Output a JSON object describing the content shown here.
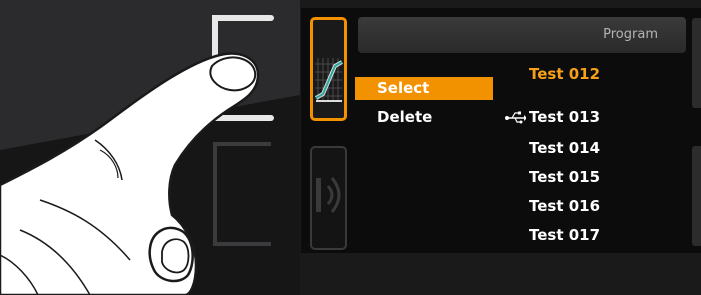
{
  "header": {
    "title": "Program"
  },
  "menu": {
    "items": [
      {
        "label": "Select",
        "selected": true
      },
      {
        "label": "Delete",
        "selected": false
      }
    ]
  },
  "programs": [
    {
      "label": "Test 012",
      "active": true,
      "usb": false
    },
    {
      "label": "Test 013",
      "active": false,
      "usb": true
    },
    {
      "label": "Test 014",
      "active": false,
      "usb": false
    },
    {
      "label": "Test 015",
      "active": false,
      "usb": false
    },
    {
      "label": "Test 016",
      "active": false,
      "usb": false
    },
    {
      "label": "Test 017",
      "active": false,
      "usb": false
    }
  ],
  "icons": {
    "tab_program": "program-curve-icon",
    "tab_second": "sound-wave-icon",
    "usb": "usb-icon"
  },
  "colors": {
    "accent": "#f39200",
    "text": "#ffffff",
    "header_text": "#b4b4b4"
  }
}
